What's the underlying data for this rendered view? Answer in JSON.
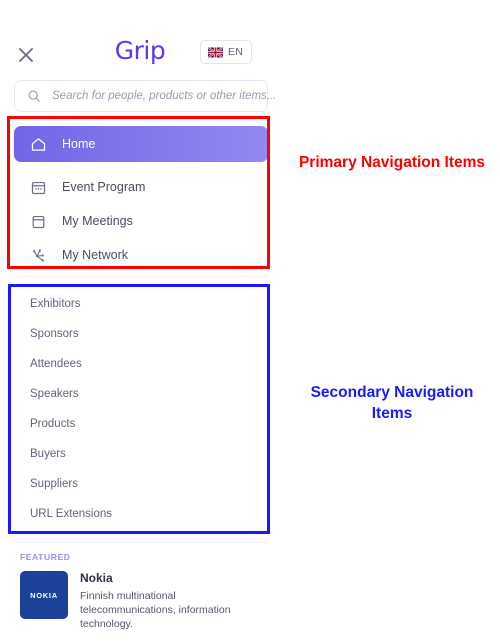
{
  "app": {
    "brand": "Grip",
    "close_icon": "close-x-icon"
  },
  "header": {
    "language": {
      "code": "EN",
      "flag_icon": "uk-flag-icon"
    }
  },
  "search": {
    "icon": "search-icon",
    "placeholder": "Search for people, products or other items...",
    "value": ""
  },
  "primary_nav": {
    "items": [
      {
        "label": "Home",
        "icon": "home-icon",
        "active": true
      },
      {
        "label": "Event Program",
        "icon": "calendar-program-icon",
        "active": false
      },
      {
        "label": "My Meetings",
        "icon": "calendar-icon",
        "active": false
      },
      {
        "label": "My Network",
        "icon": "network-icon",
        "active": false
      }
    ]
  },
  "secondary_nav": {
    "items": [
      {
        "label": "Exhibitors"
      },
      {
        "label": "Sponsors"
      },
      {
        "label": "Attendees"
      },
      {
        "label": "Speakers"
      },
      {
        "label": "Products"
      },
      {
        "label": "Buyers"
      },
      {
        "label": "Suppliers"
      },
      {
        "label": "URL Extensions"
      }
    ]
  },
  "featured": {
    "heading": "FEATURED",
    "logo_text": "NOKIA",
    "name": "Nokia",
    "description": "Finnish multinational telecommunications, information technology."
  },
  "annotations": {
    "primary": {
      "text": "Primary Navigation Items",
      "color": "#ff0000"
    },
    "secondary": {
      "text": "Secondary Navigation Items",
      "color": "#1a1aff"
    }
  },
  "colors": {
    "brand_purple": "#6633ee",
    "active_gradient_start": "#7166e6",
    "active_gradient_end": "#9289f2",
    "featured_label": "#9d8df0",
    "nokia_blue": "#1b4298"
  }
}
